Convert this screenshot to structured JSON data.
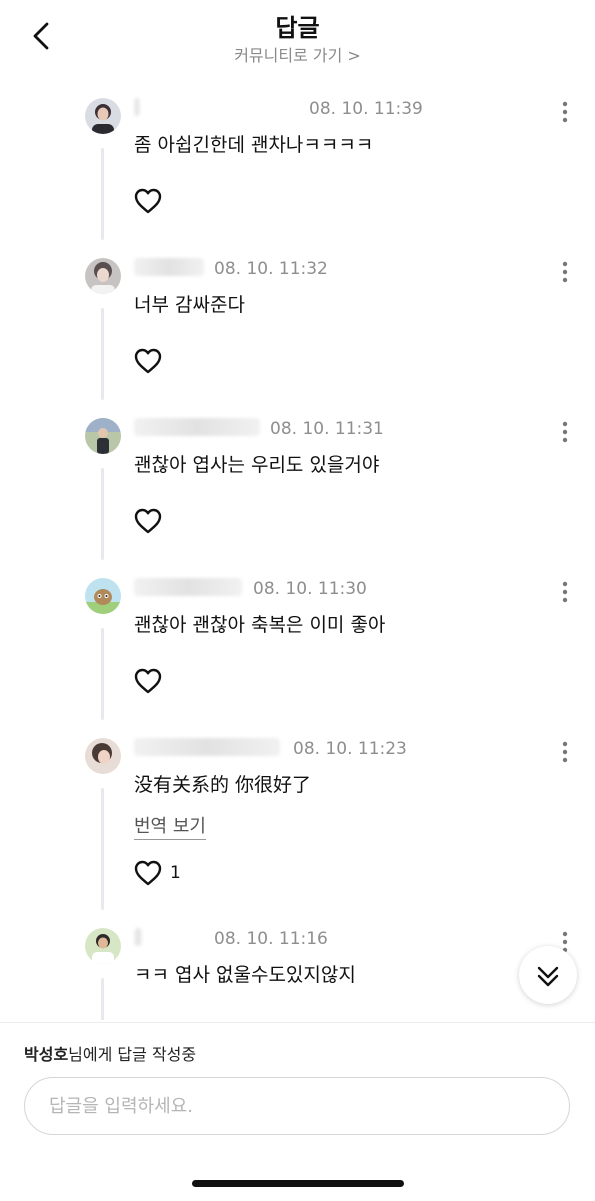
{
  "header": {
    "title": "답글",
    "subtitle": "커뮤니티로 가기 >"
  },
  "replies": [
    {
      "time": "08. 10. 11:39",
      "content": "좀 아쉽긴한데 괜차나ㅋㅋㅋㅋ"
    },
    {
      "time": "08. 10. 11:32",
      "content": "너부 감싸준다"
    },
    {
      "time": "08. 10. 11:31",
      "content": "괜찮아 엽사는 우리도 있을거야"
    },
    {
      "time": "08. 10. 11:30",
      "content": "괜찮아 괜찮아 축복은 이미 좋아"
    },
    {
      "time": "08. 10. 11:23",
      "content": "没有关系的 你很好了",
      "translate_label": "번역 보기",
      "like_count": "1"
    },
    {
      "time": "08. 10. 11:16",
      "content": "ㅋㅋ 엽사 없울수도있지않지"
    }
  ],
  "composer": {
    "reply_to_name": "박성호",
    "reply_to_suffix": "님에게 답글 작성중",
    "input_placeholder": "답글을 입력하세요."
  },
  "icons": {
    "back": "chevron-left-icon",
    "more": "more-vertical-icon",
    "like": "heart-outline-icon",
    "scroll": "double-chevron-down-icon"
  }
}
